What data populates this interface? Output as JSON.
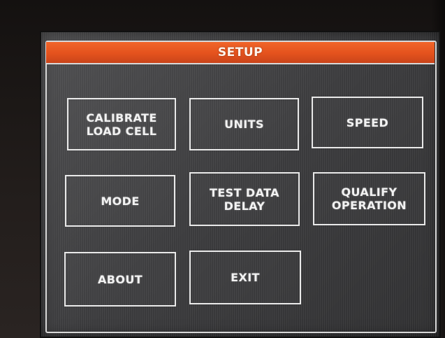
{
  "screen": {
    "title": "SETUP"
  },
  "buttons": {
    "calibrate_load_cell": [
      "CALIBRATE",
      "LOAD CELL"
    ],
    "units": "UNITS",
    "speed": "SPEED",
    "mode": "MODE",
    "test_data_delay": [
      "TEST DATA",
      "DELAY"
    ],
    "qualify_operation": [
      "QUALIFY",
      "OPERATION"
    ],
    "about": "ABOUT",
    "exit": "EXIT"
  },
  "colors": {
    "title_bar": "#e4521d",
    "screen_background": "#3b3b3d",
    "button_border": "#e9e9e9",
    "text": "#f2f2f2"
  }
}
